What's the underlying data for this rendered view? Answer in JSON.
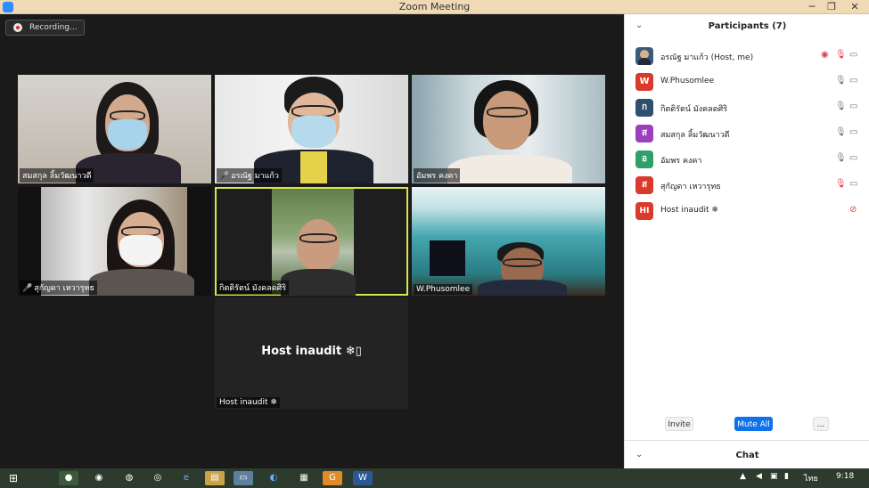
{
  "window": {
    "title": "Zoom Meeting",
    "minimize": "─",
    "maximize": "❐",
    "close": "✕"
  },
  "recording": {
    "label": "Recording..."
  },
  "tiles": [
    {
      "name": "สมสกุล  ลิ้มวัฒนาวดี",
      "muted": false
    },
    {
      "name": "อรณัฐ มาแก้ว",
      "muted": true
    },
    {
      "name": "อัมพร  คงคา",
      "muted": false
    },
    {
      "name": "สุกัญดา  เหวารุทธ",
      "muted": true
    },
    {
      "name": "กิตติรัตน์ มังคลดศิริ",
      "muted": false
    },
    {
      "name": "W.Phusomlee",
      "muted": false
    }
  ],
  "host_tile": {
    "big_label": "Host inaudit ❄▯",
    "name": "Host inaudit ❄"
  },
  "participants_panel": {
    "title": "Participants (7)",
    "items": [
      {
        "initial": "",
        "name": "อรณัฐ มาแก้ว (Host, me)",
        "color": "#3b5b7a"
      },
      {
        "initial": "W",
        "name": "W.Phusomlee",
        "color": "#d93a2b"
      },
      {
        "initial": "ก",
        "name": "กิตติรัตน์ มังคลดศิริ",
        "color": "#2f4f6f"
      },
      {
        "initial": "ส",
        "name": "สมสกุล  ลิ้มวัฒนาวดี",
        "color": "#9b3fbf"
      },
      {
        "initial": "อ",
        "name": "อัมพร  คงคา",
        "color": "#2fa06a"
      },
      {
        "initial": "ส",
        "name": "สุกัญดา  เหวารุทธ",
        "color": "#d93a2b"
      },
      {
        "initial": "HI",
        "name": "Host inaudit ❄",
        "color": "#d93a2b"
      }
    ],
    "invite": "Invite",
    "mute_all": "Mute All",
    "more": "...",
    "chat": "Chat"
  },
  "taskbar": {
    "language": "ไทย",
    "time": "9:18"
  },
  "colors": {
    "accent": "#0e72ed",
    "active_speaker": "#d7e64b",
    "muted": "#e04040"
  }
}
